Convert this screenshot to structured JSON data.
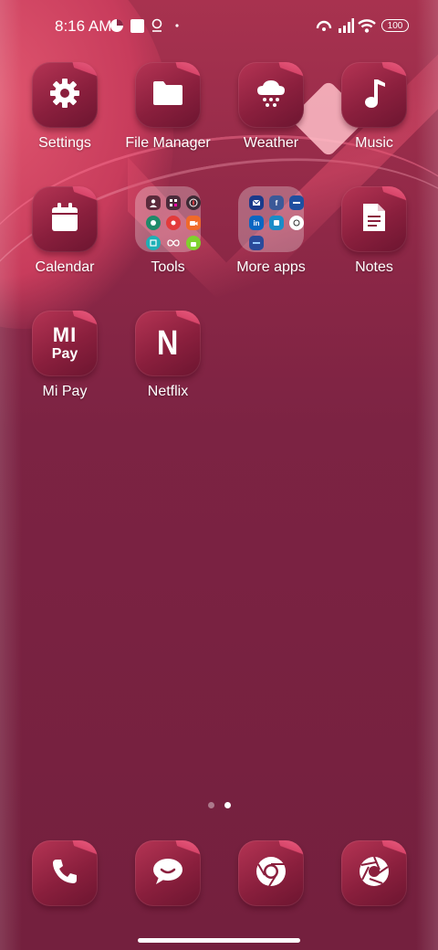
{
  "status_bar": {
    "time": "8:16 AM",
    "battery": "100"
  },
  "apps": {
    "settings": "Settings",
    "file_manager": "File Manager",
    "weather": "Weather",
    "music": "Music",
    "calendar": "Calendar",
    "tools": "Tools",
    "more_apps": "More apps",
    "notes": "Notes",
    "mi_pay": "Mi Pay",
    "netflix": "Netflix"
  },
  "mi_pay_glyph": {
    "top": "MI",
    "bottom": "Pay"
  },
  "netflix_glyph": "N",
  "tools_folder": [
    "contacts-icon",
    "calculator-icon",
    "compass-icon",
    "app-icon",
    "recorder-icon",
    "screen-recorder-icon",
    "scanner-icon",
    "mi-remote-icon",
    "android-icon"
  ],
  "more_apps_folder": [
    "mail-icon",
    "facebook-icon",
    "app-icon",
    "linkedin-icon",
    "app-icon",
    "chat-icon",
    "app-icon"
  ],
  "pager": {
    "pages": 2,
    "active": 2
  },
  "dock": [
    "phone-icon",
    "messages-icon",
    "chrome-icon",
    "camera-icon"
  ],
  "colors": {
    "accent": "#c83c5c",
    "background": "#7a2241"
  }
}
